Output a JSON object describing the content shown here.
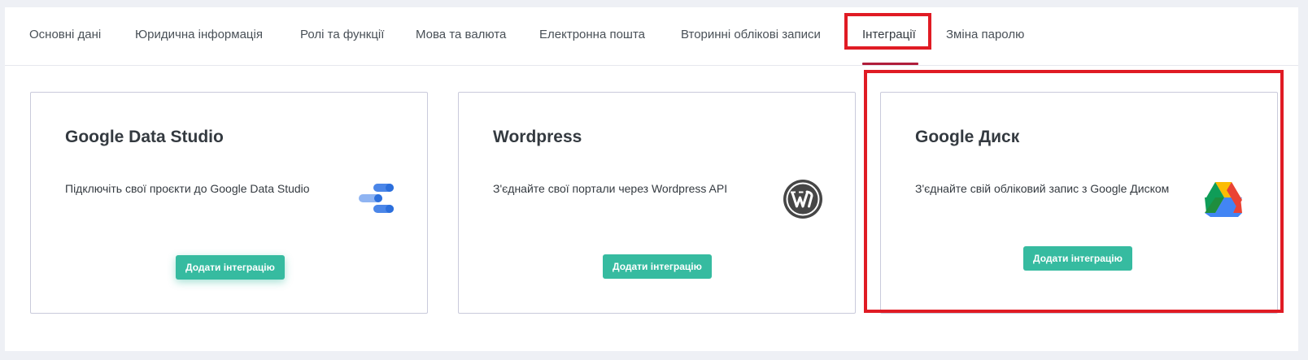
{
  "tabs": [
    {
      "label": "Основні дані"
    },
    {
      "label": "Юридична інформація"
    },
    {
      "label": "Ролі та функції"
    },
    {
      "label": "Мова та валюта"
    },
    {
      "label": "Електронна пошта"
    },
    {
      "label": "Вторинні облікові записи"
    },
    {
      "label": "Інтеграції",
      "active": true
    },
    {
      "label": "Зміна паролю"
    }
  ],
  "cards": [
    {
      "title": "Google Data Studio",
      "description": "Підключіть свої проєкти до Google Data Studio",
      "icon": "google-data-studio-icon",
      "button_label": "Додати інтеграцію"
    },
    {
      "title": "Wordpress",
      "description": "З'єднайте свої портали через Wordpress API",
      "icon": "wordpress-icon",
      "button_label": "Додати інтеграцію"
    },
    {
      "title": "Google Диск",
      "description": "З'єднайте свій обліковий запис з Google Диском",
      "icon": "google-drive-icon",
      "button_label": "Додати інтеграцію"
    }
  ],
  "colors": {
    "accent_button": "#36bba0",
    "active_tab_underline": "#b01d3a",
    "highlight_box": "#e01b24"
  }
}
